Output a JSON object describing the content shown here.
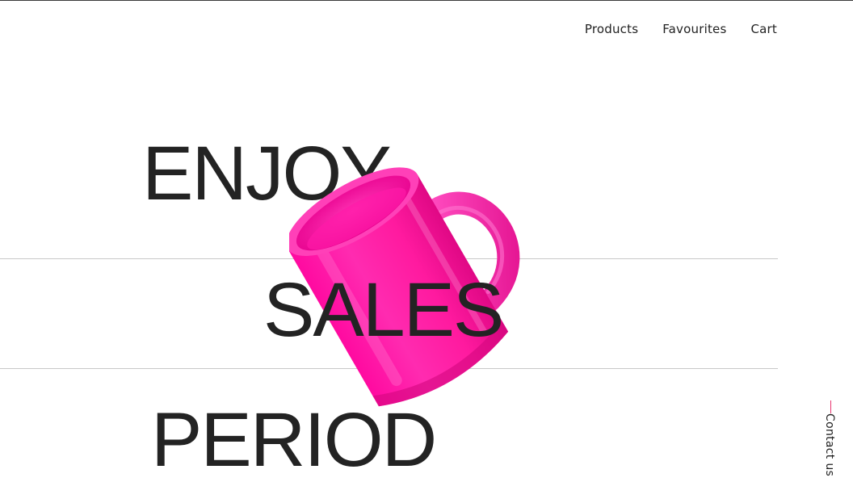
{
  "nav": {
    "items": [
      {
        "label": "Products"
      },
      {
        "label": "Favourites"
      },
      {
        "label": "Cart"
      }
    ]
  },
  "hero": {
    "line1": "ENJOY",
    "line2": "SALES",
    "line3": "PERIOD",
    "image": "pink-mug",
    "accent_color": "#ff1493"
  },
  "side": {
    "contact_label": "Contact us",
    "accent_color": "#e8336e"
  }
}
